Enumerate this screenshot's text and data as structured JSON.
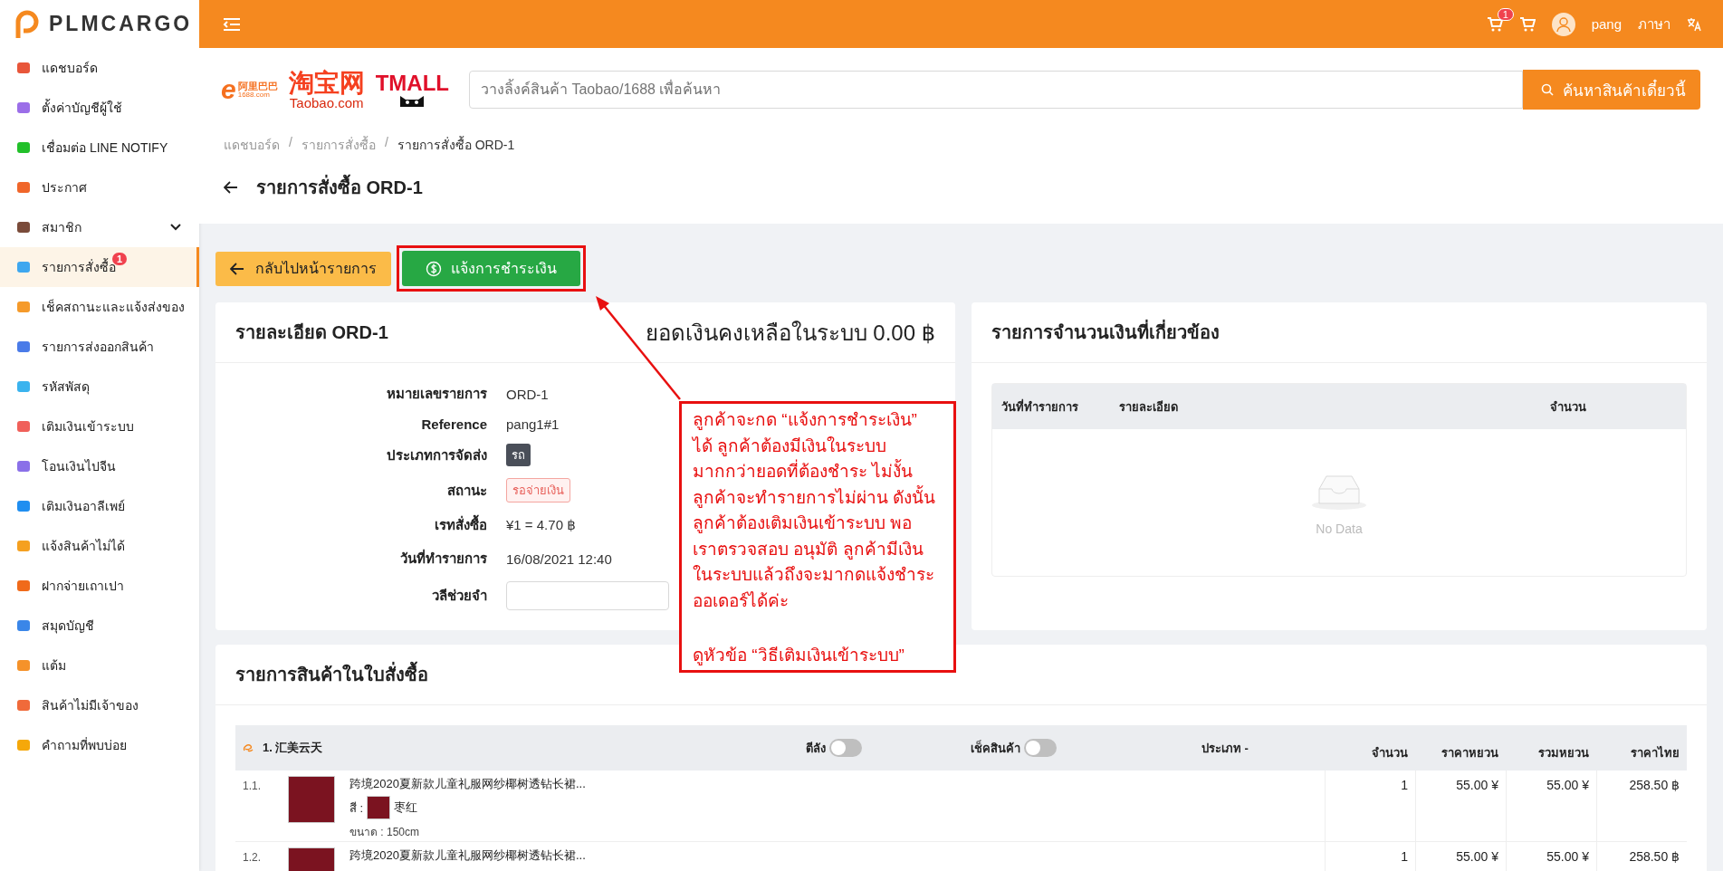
{
  "brand": {
    "name": "PLMCARGO"
  },
  "sidebar": {
    "items": [
      {
        "label": "แดชบอร์ด",
        "kind": "link",
        "selected": false,
        "color": "#e8563a"
      },
      {
        "label": "ตั้งค่าบัญชีผู้ใช้",
        "kind": "link",
        "selected": false,
        "color": "#9b6ee8"
      },
      {
        "label": "เชื่อมต่อ LINE NOTIFY",
        "kind": "link",
        "selected": false,
        "color": "#22c02a"
      },
      {
        "label": "ประกาศ",
        "kind": "link",
        "selected": false,
        "color": "#f0662a"
      },
      {
        "label": "สมาชิก",
        "kind": "group",
        "selected": false,
        "color": "#7a4b3a"
      },
      {
        "label": "รายการสั่งซื้อ",
        "kind": "link",
        "selected": true,
        "badge": "1",
        "color": "#3ea7ef"
      },
      {
        "label": "เช็คสถานะและแจ้งส่งของ",
        "kind": "link",
        "selected": false,
        "color": "#f59a2a"
      },
      {
        "label": "รายการส่งออกสินค้า",
        "kind": "link",
        "selected": false,
        "color": "#4a7be8"
      },
      {
        "label": "รหัสพัสดุ",
        "kind": "link",
        "selected": false,
        "color": "#3ab3ee"
      },
      {
        "label": "เติมเงินเข้าระบบ",
        "kind": "link",
        "selected": false,
        "color": "#f0605a"
      },
      {
        "label": "โอนเงินไปจีน",
        "kind": "link",
        "selected": false,
        "color": "#8a70e8"
      },
      {
        "label": "เติมเงินอาลีเพย์",
        "kind": "link",
        "selected": false,
        "color": "#1f8ef0"
      },
      {
        "label": "แจ้งสินค้าไม่ได้",
        "kind": "link",
        "selected": false,
        "color": "#f5a020"
      },
      {
        "label": "ฝากจ่ายเถาเปา",
        "kind": "link",
        "selected": false,
        "color": "#f06a1a"
      },
      {
        "label": "สมุดบัญชี",
        "kind": "link",
        "selected": false,
        "color": "#3a86e8"
      },
      {
        "label": "แต้ม",
        "kind": "link",
        "selected": false,
        "color": "#f5922a"
      },
      {
        "label": "สินค้าไม่มีเจ้าของ",
        "kind": "link",
        "selected": false,
        "color": "#f06a3a"
      },
      {
        "label": "คำถามที่พบบ่อย",
        "kind": "link",
        "selected": false,
        "color": "#f5a80a"
      }
    ]
  },
  "topbar": {
    "cart_badge": "1",
    "user": "pang",
    "language": "ภาษา"
  },
  "logos": [
    {
      "kind": "alibaba",
      "letter": "e",
      "mark": "阿里巴巴",
      "sub": "1688.com"
    },
    {
      "kind": "taobao",
      "mark": "淘宝网",
      "sub": "Taobao.com"
    },
    {
      "kind": "tmall",
      "mark": "TMALL"
    }
  ],
  "search": {
    "placeholder": "วางลิ้งค์สินค้า Taobao/1688 เพื่อค้นหา",
    "button": "ค้นหาสินค้าเดี๋ยวนี้"
  },
  "breadcrumb": [
    "แดชบอร์ด",
    "รายการสั่งซื้อ",
    "รายการสั่งซื้อ ORD-1"
  ],
  "breadcrumb_separator": "/",
  "page_title": "รายการสั่งซื้อ ORD-1",
  "actions": {
    "back": "กลับไปหน้ารายการ",
    "notify_payment": "แจ้งการชำระเงิน"
  },
  "detail": {
    "title": "รายละเอียด ORD-1",
    "balance": "ยอดเงินคงเหลือในระบบ 0.00 ฿",
    "fields": [
      {
        "label": "หมายเลขรายการ",
        "kind": "text",
        "value": "ORD-1"
      },
      {
        "label": "Reference",
        "kind": "text",
        "value": "pang1#1"
      },
      {
        "label": "ประเภทการจัดส่ง",
        "kind": "tag",
        "value": "รถ"
      },
      {
        "label": "สถานะ",
        "kind": "status",
        "value": "รอจ่ายเงิน"
      },
      {
        "label": "เรทสั่งซื้อ",
        "kind": "text",
        "value": "¥1 = 4.70 ฿"
      },
      {
        "label": "วันที่ทำรายการ",
        "kind": "text",
        "value": "16/08/2021 12:40"
      },
      {
        "label": "วลีช่วยจำ",
        "kind": "input"
      }
    ]
  },
  "related": {
    "title": "รายการจำนวนเงินที่เกี่ยวข้อง",
    "columns": [
      "วันที่ทำรายการ",
      "รายละเอียด",
      "จำนวน"
    ],
    "empty": "No Data"
  },
  "products": {
    "title": "รายการสินค้าในใบสั่งซื้อ",
    "shop": "1. 汇美云天",
    "toggles": [
      {
        "label": "ตีลัง",
        "on": false
      },
      {
        "label": "เช็คสินค้า",
        "on": false
      }
    ],
    "type": "ประเภท -",
    "columns": [
      "จำนวน",
      "ราคาหยวน",
      "รวมหยวน",
      "ราคาไทย"
    ],
    "rows": [
      {
        "no": "1.1.",
        "name": "跨境2020夏新款儿童礼服网纱椰树透钻长裙...",
        "color_label": "สี :",
        "color_name": "枣红",
        "size": "ขนาด : 150cm",
        "qty": "1",
        "price": "55.00 ¥",
        "total": "55.00 ¥",
        "thb": "258.50 ฿"
      },
      {
        "no": "1.2.",
        "name": "跨境2020夏新款儿童礼服网纱椰树透钻长裙...",
        "qty": "1",
        "price": "55.00 ¥",
        "total": "55.00 ¥",
        "thb": "258.50 ฿"
      }
    ]
  },
  "annotation": {
    "text": "ลูกค้าจะกด “แจ้งการชำระเงิน”\nได้ ลูกค้าต้องมีเงินในระบบ\nมากกว่ายอดที่ต้องชำระ ไม่งั้น\nลูกค้าจะทำรายการไม่ผ่าน ดังนั้น\nลูกค้าต้องเติมเงินเข้าระบบ พอ\nเราตรวจสอบ อนุมัติ ลูกค้ามีเงิน\nในระบบแล้วถึงจะมากดแจ้งชำระ\nออเดอร์ได้ค่ะ",
    "note": "ดูหัวข้อ “วิธีเติมเงินเข้าระบบ”"
  }
}
